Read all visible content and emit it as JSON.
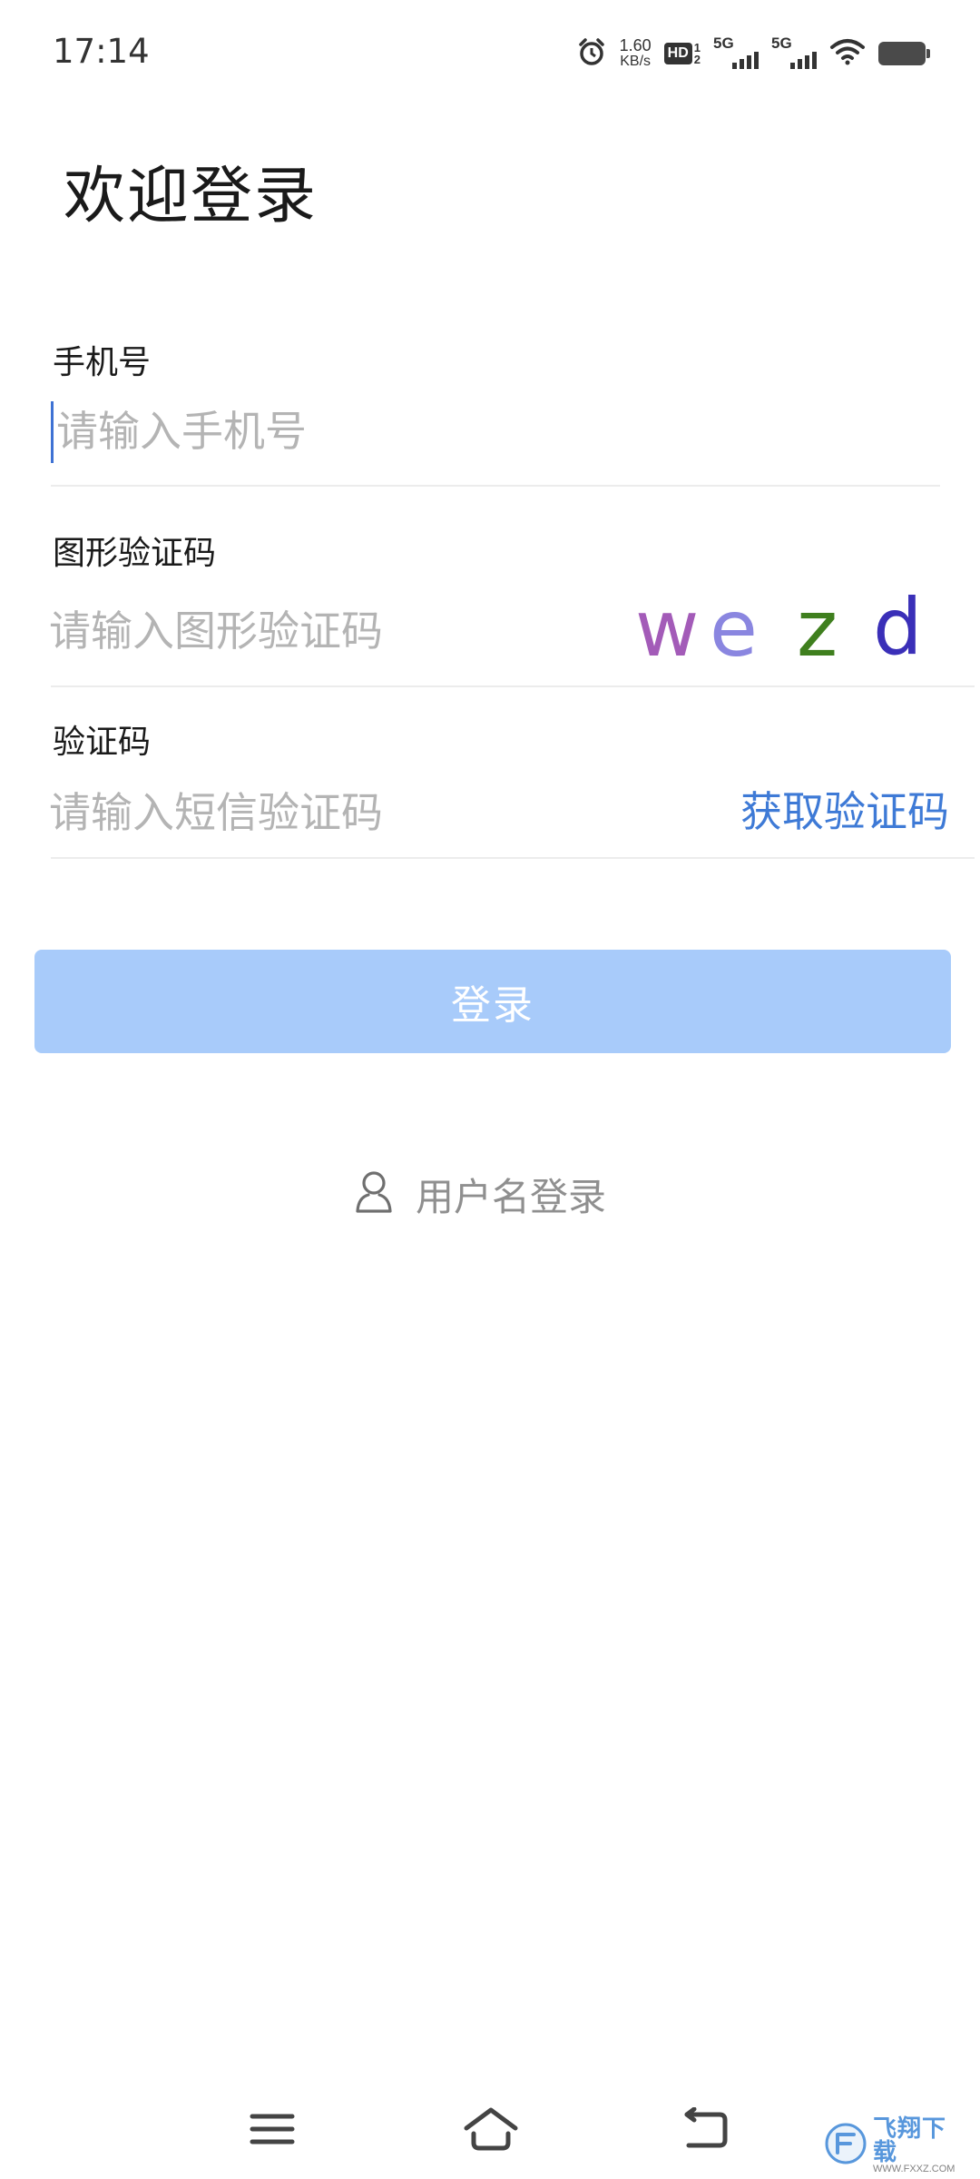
{
  "status_bar": {
    "time": "17:14",
    "net_speed_value": "1.60",
    "net_speed_unit": "KB/s",
    "hd_label": "HD",
    "sim1_label": "5G",
    "sim2_label": "5G",
    "icons": [
      "alarm-icon",
      "hd-icon",
      "signal-icon",
      "signal-icon",
      "wifi-icon",
      "battery-icon"
    ]
  },
  "page": {
    "title": "欢迎登录"
  },
  "form": {
    "phone": {
      "label": "手机号",
      "placeholder": "请输入手机号",
      "value": ""
    },
    "captcha": {
      "label": "图形验证码",
      "placeholder": "请输入图形验证码",
      "value": "",
      "image_text": [
        "w",
        "e",
        "z",
        "d"
      ],
      "image_colors": [
        "#a35bb8",
        "#8a86e0",
        "#3f7f1e",
        "#3a2fb8"
      ]
    },
    "sms": {
      "label": "验证码",
      "placeholder": "请输入短信验证码",
      "value": "",
      "get_code_label": "获取验证码"
    },
    "login_button": "登录",
    "username_login": "用户名登录"
  },
  "nav_bar": {
    "buttons": [
      "menu-icon",
      "home-icon",
      "back-icon"
    ]
  },
  "watermark": {
    "text_cn": "飞翔下载",
    "text_en": "WWW.FXXZ.COM"
  },
  "colors": {
    "accent": "#3e7ad6",
    "button_disabled": "#a8cbfa",
    "placeholder": "#b4b4b4",
    "divider": "#ececec"
  }
}
